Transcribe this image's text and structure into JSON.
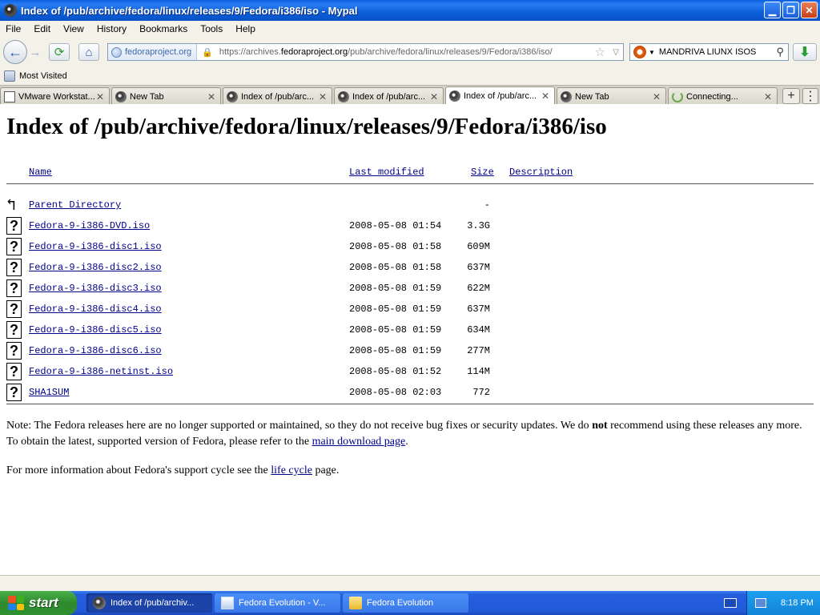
{
  "window": {
    "title": "Index of /pub/archive/fedora/linux/releases/9/Fedora/i386/iso - Mypal",
    "min_glyph": "▁",
    "max_glyph": "❐",
    "close_glyph": "✕"
  },
  "menu": [
    "File",
    "Edit",
    "View",
    "History",
    "Bookmarks",
    "Tools",
    "Help"
  ],
  "nav": {
    "back_glyph": "←",
    "forward_glyph": "→",
    "reload_glyph": "⟳",
    "home_glyph": "⌂",
    "identity": "fedoraproject.org",
    "url_prefix": "https://archives.",
    "url_domain": "fedoraproject.org",
    "url_path": "/pub/archive/fedora/linux/releases/9/Fedora/i386/iso/",
    "star_glyph": "☆",
    "drop_glyph": "▽",
    "search_value": "MANDRIVA LIUNX ISOS",
    "search_glyph": "⚲",
    "download_glyph": "⬇"
  },
  "bookmarks": {
    "most_visited": "Most Visited"
  },
  "tabs": [
    {
      "label": "VMware Workstat...",
      "icon": "vm"
    },
    {
      "label": "New Tab",
      "icon": "pal"
    },
    {
      "label": "Index of /pub/arc...",
      "icon": "pal"
    },
    {
      "label": "Index of /pub/arc...",
      "icon": "pal"
    },
    {
      "label": "Index of /pub/arc...",
      "icon": "pal",
      "active": true
    },
    {
      "label": "New Tab",
      "icon": "pal"
    },
    {
      "label": "Connecting...",
      "icon": "spin"
    }
  ],
  "tab_close_glyph": "✕",
  "tabstrip": {
    "new_tab_glyph": "+",
    "list_glyph": "⋮"
  },
  "page": {
    "heading": "Index of /pub/archive/fedora/linux/releases/9/Fedora/i386/iso",
    "headers": {
      "name": "Name",
      "last_modified": "Last modified",
      "size": "Size",
      "description": "Description"
    },
    "parent": {
      "name": "Parent Directory",
      "size": "-",
      "icon_glyph": "↰"
    },
    "file_icon_glyph": "?",
    "files": [
      {
        "name": "Fedora-9-i386-DVD.iso",
        "date": "2008-05-08 01:54",
        "size": "3.3G"
      },
      {
        "name": "Fedora-9-i386-disc1.iso",
        "date": "2008-05-08 01:58",
        "size": "609M"
      },
      {
        "name": "Fedora-9-i386-disc2.iso",
        "date": "2008-05-08 01:58",
        "size": "637M"
      },
      {
        "name": "Fedora-9-i386-disc3.iso",
        "date": "2008-05-08 01:59",
        "size": "622M"
      },
      {
        "name": "Fedora-9-i386-disc4.iso",
        "date": "2008-05-08 01:59",
        "size": "637M"
      },
      {
        "name": "Fedora-9-i386-disc5.iso",
        "date": "2008-05-08 01:59",
        "size": "634M"
      },
      {
        "name": "Fedora-9-i386-disc6.iso",
        "date": "2008-05-08 01:59",
        "size": "277M"
      },
      {
        "name": "Fedora-9-i386-netinst.iso",
        "date": "2008-05-08 01:52",
        "size": "114M"
      },
      {
        "name": "SHA1SUM",
        "date": "2008-05-08 02:03",
        "size": "772"
      }
    ],
    "note": {
      "part1": "Note: The Fedora releases here are no longer supported or maintained, so they do not receive bug fixes or security updates. We do ",
      "bold": "not",
      "part2": " recommend using these releases any more. To obtain the latest, supported version of Fedora, please refer to the ",
      "link": "main download page",
      "part3": "."
    },
    "info": {
      "part1": "For more information about Fedora's support cycle see the ",
      "link": "life cycle",
      "part2": " page."
    }
  },
  "taskbar": {
    "start": "start",
    "tasks": [
      {
        "label": "Index of /pub/archiv...",
        "icon": "pal",
        "active": true
      },
      {
        "label": "Fedora Evolution - V...",
        "icon": "web",
        "active": false
      },
      {
        "label": "Fedora Evolution",
        "icon": "folder",
        "active": false
      }
    ],
    "clock": "8:18 PM"
  }
}
